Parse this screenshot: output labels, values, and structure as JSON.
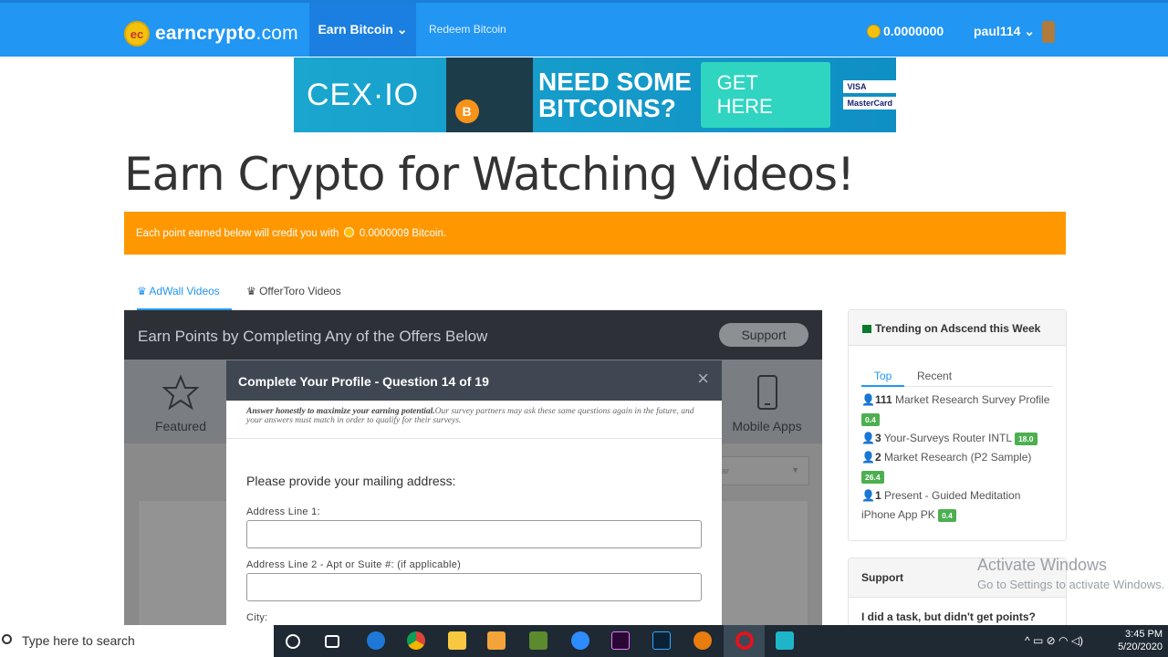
{
  "nav": {
    "logo_badge": "ec",
    "logo_name": "earncrypto",
    "logo_tld": ".com",
    "earn": "Earn Bitcoin ⌄",
    "redeem": "Redeem Bitcoin",
    "balance": "0.0000000",
    "user": "paul114 ⌄"
  },
  "banner": {
    "brand": "CEX·IO",
    "headline_1": "NEED SOME",
    "headline_2": "BITCOINS?",
    "cta": "GET HERE",
    "card1": "VISA",
    "card2": "MasterCard",
    "coin": "B"
  },
  "page": {
    "title": "Earn Crypto for Watching Videos!",
    "notice_pre": "Each point earned below will credit you with",
    "notice_amount": "0.0000009 Bitcoin."
  },
  "tabs": [
    "♛ AdWall Videos",
    "♛ OfferToro Videos"
  ],
  "panel": {
    "title": "Earn Points by Completing Any of the Offers Below",
    "support": "Support",
    "featured": "Featured",
    "mobile": "Mobile Apps",
    "select": "lar"
  },
  "modal": {
    "title": "Complete Your Profile - Question 14 of 19",
    "close": "×",
    "note_bold": "Answer honestly to maximize your earning potential.",
    "note_rest": "Our survey partners may ask these same questions again in the future, and your answers must match in order to qualify for their surveys.",
    "question": "Please provide your mailing address:",
    "label1": "Address Line 1:",
    "label2": "Address Line 2 - Apt or Suite #: (if applicable)",
    "label3": "City:"
  },
  "sidebar": {
    "title": "Trending on Adscend this Week",
    "tab_top": "Top",
    "tab_recent": "Recent",
    "items": [
      {
        "count": "111",
        "name": "Market Research Survey Profile",
        "points": "0.4"
      },
      {
        "count": "3",
        "name": "Your-Surveys Router INTL",
        "points": "18.0"
      },
      {
        "count": "2",
        "name": "Market Research (P2 Sample)",
        "points": "26.4"
      },
      {
        "count": "1",
        "name": "Present - Guided Meditation iPhone App PK",
        "points": "0.4"
      }
    ]
  },
  "support_box": {
    "title": "Support",
    "question": "I did a task, but didn't get points?"
  },
  "watermark": {
    "line1": "Activate Windows",
    "line2": "Go to Settings to activate Windows."
  },
  "taskbar": {
    "search": "Type here to search",
    "time": "3:45 PM",
    "date": "5/20/2020"
  }
}
